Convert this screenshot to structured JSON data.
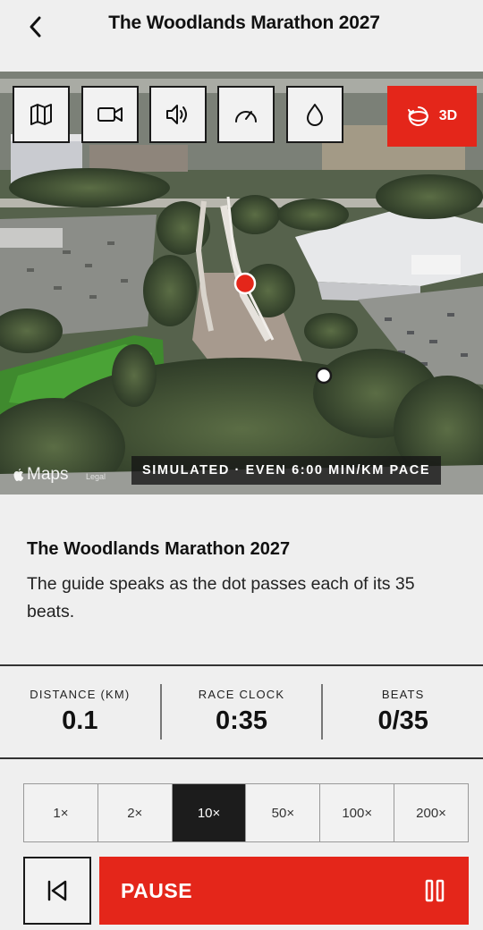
{
  "header": {
    "title": "The Woodlands Marathon 2027",
    "back_icon": "chevron-left-icon"
  },
  "map": {
    "toolbar": [
      {
        "name": "map-view-button",
        "icon": "map-icon"
      },
      {
        "name": "camera-button",
        "icon": "video-camera-icon"
      },
      {
        "name": "audio-button",
        "icon": "speaker-icon"
      },
      {
        "name": "pace-button",
        "icon": "speedometer-icon"
      },
      {
        "name": "hydration-button",
        "icon": "water-drop-icon"
      }
    ],
    "view_mode_label": "3D",
    "brand": "Maps",
    "legal": "Legal",
    "simulation_label": "SIMULATED · EVEN 6:00 MIN/KM PACE"
  },
  "description": {
    "title": "The Woodlands Marathon 2027",
    "body": "The guide speaks as the dot passes each of its 35 beats."
  },
  "stats": [
    {
      "label": "DISTANCE (KM)",
      "value": "0.1"
    },
    {
      "label": "RACE CLOCK",
      "value": "0:35"
    },
    {
      "label": "BEATS",
      "value": "0/35"
    }
  ],
  "speeds": {
    "options": [
      "1×",
      "2×",
      "10×",
      "50×",
      "100×",
      "200×"
    ],
    "selected": "10×"
  },
  "controls": {
    "pause_label": "PAUSE"
  },
  "colors": {
    "accent": "#e4261a",
    "background": "#efefef",
    "selected": "#1c1c1c"
  }
}
